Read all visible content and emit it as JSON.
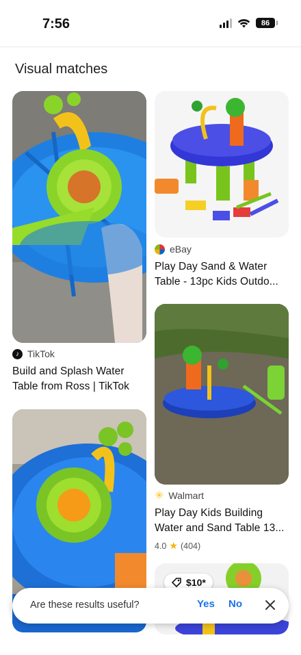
{
  "status_bar": {
    "time": "7:56",
    "battery": "86"
  },
  "section_title": "Visual matches",
  "results": [
    {
      "source": "TikTok",
      "source_icon": "tiktok-icon",
      "title_line1": "Build and Splash Water",
      "title_line2": "Table from Ross | TikTok"
    },
    {
      "source": "eBay",
      "source_icon": "ebay-icon",
      "title_line1": "Play Day Sand & Water",
      "title_line2": "Table - 13pc Kids Outdo..."
    },
    {
      "source": "Walmart",
      "source_icon": "walmart-icon",
      "title_line1": "Play Day Kids Building",
      "title_line2": "Water and Sand Table 13...",
      "rating": "4.0",
      "reviews": "(404)"
    }
  ],
  "price_badge": "$10*",
  "feedback": {
    "question": "Are these results useful?",
    "yes": "Yes",
    "no": "No"
  },
  "colors": {
    "accent": "#1a73e8",
    "toy_blue": "#1e4fd8",
    "toy_green": "#7ccf1e",
    "toy_yellow": "#f5c400",
    "star": "#f4b400"
  }
}
